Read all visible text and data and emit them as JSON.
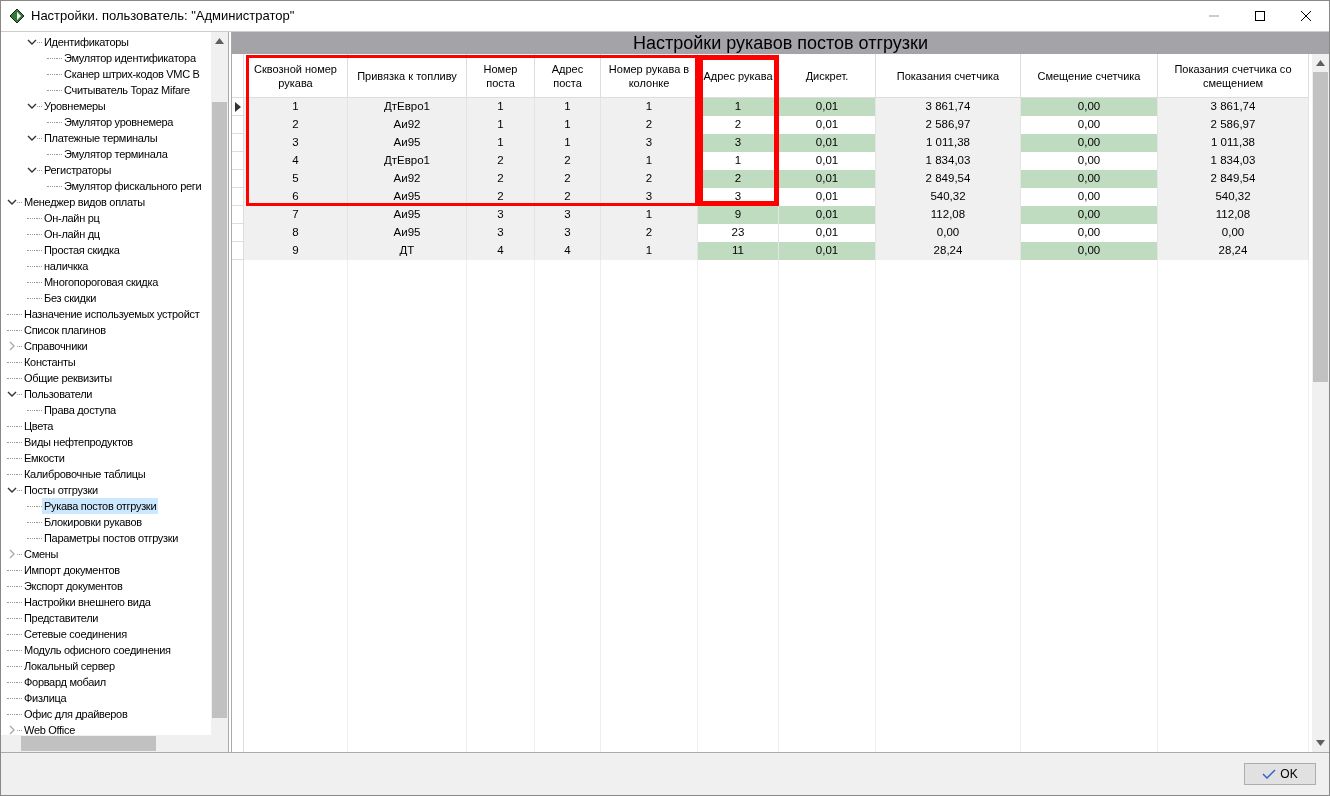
{
  "window": {
    "title": "Настройки. пользователь: \"Администратор\""
  },
  "tree": {
    "continued_items": [
      {
        "label": "Идентификаторы",
        "expanded": true,
        "selected": false,
        "children": [
          {
            "label": "Эмулятор идентификатора",
            "selected": false
          },
          {
            "label": "Сканер штрих-кодов VMC B",
            "selected": false
          },
          {
            "label": "Считыватель Topaz Mifare",
            "selected": false
          }
        ]
      },
      {
        "label": "Уровнемеры",
        "expanded": true,
        "selected": false,
        "children": [
          {
            "label": "Эмулятор уровнемера",
            "selected": false
          }
        ]
      },
      {
        "label": "Платежные терминалы",
        "expanded": true,
        "selected": false,
        "children": [
          {
            "label": "Эмулятор терминала",
            "selected": false
          }
        ]
      },
      {
        "label": "Регистраторы",
        "expanded": true,
        "selected": false,
        "children": [
          {
            "label": "Эмулятор фискального реги",
            "selected": false
          }
        ]
      }
    ],
    "items": [
      {
        "label": "Менеджер видов оплаты",
        "expanded": true,
        "selected": false,
        "children": [
          {
            "label": "Он-лайн рц",
            "selected": false
          },
          {
            "label": "Он-лайн дц",
            "selected": false
          },
          {
            "label": "Простая скидка",
            "selected": false
          },
          {
            "label": "наличкка",
            "selected": false
          },
          {
            "label": "Многопороговая скидка",
            "selected": false
          },
          {
            "label": "Без скидки",
            "selected": false
          }
        ]
      },
      {
        "label": "Назначение используемых устройст",
        "selected": false
      },
      {
        "label": "Список плагинов",
        "selected": false
      },
      {
        "label": "Справочники",
        "expanded": false,
        "selected": false
      },
      {
        "label": "Константы",
        "selected": false
      },
      {
        "label": "Общие реквизиты",
        "selected": false
      },
      {
        "label": "Пользователи",
        "expanded": true,
        "selected": false,
        "children": [
          {
            "label": "Права доступа",
            "selected": false
          }
        ]
      },
      {
        "label": "Цвета",
        "selected": false
      },
      {
        "label": "Виды нефтепродуктов",
        "selected": false
      },
      {
        "label": "Емкости",
        "selected": false
      },
      {
        "label": "Калибровочные таблицы",
        "selected": false
      },
      {
        "label": "Посты отгрузки",
        "expanded": true,
        "selected": false,
        "children": [
          {
            "label": "Рукава постов отгрузки",
            "selected": true
          },
          {
            "label": "Блокировки рукавов",
            "selected": false
          },
          {
            "label": "Параметры постов отгрузки",
            "selected": false
          }
        ]
      },
      {
        "label": "Смены",
        "expanded": false,
        "selected": false
      },
      {
        "label": "Импорт документов",
        "selected": false
      },
      {
        "label": "Экспорт документов",
        "selected": false
      },
      {
        "label": "Настройки внешнего вида",
        "selected": false
      },
      {
        "label": "Представители",
        "selected": false
      },
      {
        "label": "Сетевые соединения",
        "selected": false
      },
      {
        "label": "Модуль офисного соединения",
        "selected": false
      },
      {
        "label": "Локальный сервер",
        "selected": false
      },
      {
        "label": "Форвард мобаил",
        "selected": false
      },
      {
        "label": "Физлица",
        "selected": false
      },
      {
        "label": "Офис для драйверов",
        "selected": false
      },
      {
        "label": "Web Office",
        "expanded": false,
        "selected": false
      }
    ]
  },
  "panel": {
    "title": "Настройки рукавов постов отгрузки"
  },
  "table": {
    "columns": [
      {
        "label": "Сквозной номер рукава",
        "kind": "readonly",
        "framed": true,
        "frame_thick": false
      },
      {
        "label": "Привязка к топливу",
        "kind": "readonly",
        "framed": true,
        "frame_thick": false
      },
      {
        "label": "Номер поста",
        "kind": "readonly",
        "framed": true,
        "frame_thick": false
      },
      {
        "label": "Адрес поста",
        "kind": "readonly",
        "framed": true,
        "frame_thick": false
      },
      {
        "label": "Номер рукава в колонке",
        "kind": "readonly",
        "framed": true,
        "frame_thick": false
      },
      {
        "label": "Адрес рукава",
        "kind": "editable",
        "framed": true,
        "frame_thick": true
      },
      {
        "label": "Дискрет.",
        "kind": "editable",
        "framed": false
      },
      {
        "label": "Показания счетчика",
        "kind": "readonly",
        "framed": false
      },
      {
        "label": "Смещение счетчика",
        "kind": "editable",
        "framed": false
      },
      {
        "label": "Показания счетчика со смещением",
        "kind": "readonly",
        "framed": false
      }
    ],
    "rows": [
      {
        "current": true,
        "framed": true,
        "cells": [
          "1",
          "ДтЕвро1",
          "1",
          "1",
          "1",
          "1",
          "0,01",
          "3 861,74",
          "0,00",
          "3 861,74"
        ]
      },
      {
        "current": false,
        "framed": true,
        "cells": [
          "2",
          "Аи92",
          "1",
          "1",
          "2",
          "2",
          "0,01",
          "2 586,97",
          "0,00",
          "2 586,97"
        ]
      },
      {
        "current": false,
        "framed": true,
        "cells": [
          "3",
          "Аи95",
          "1",
          "1",
          "3",
          "3",
          "0,01",
          "1 011,38",
          "0,00",
          "1 011,38"
        ]
      },
      {
        "current": false,
        "framed": true,
        "cells": [
          "4",
          "ДтЕвро1",
          "2",
          "2",
          "1",
          "1",
          "0,01",
          "1 834,03",
          "0,00",
          "1 834,03"
        ]
      },
      {
        "current": false,
        "framed": true,
        "cells": [
          "5",
          "Аи92",
          "2",
          "2",
          "2",
          "2",
          "0,01",
          "2 849,54",
          "0,00",
          "2 849,54"
        ]
      },
      {
        "current": false,
        "framed": true,
        "cells": [
          "6",
          "Аи95",
          "2",
          "2",
          "3",
          "3",
          "0,01",
          "540,32",
          "0,00",
          "540,32"
        ]
      },
      {
        "current": false,
        "framed": false,
        "cells": [
          "7",
          "Аи95",
          "3",
          "3",
          "1",
          "9",
          "0,01",
          "112,08",
          "0,00",
          "112,08"
        ]
      },
      {
        "current": false,
        "framed": false,
        "cells": [
          "8",
          "Аи95",
          "3",
          "3",
          "2",
          "23",
          "0,01",
          "0,00",
          "0,00",
          "0,00"
        ]
      },
      {
        "current": false,
        "framed": false,
        "cells": [
          "9",
          "ДТ",
          "4",
          "4",
          "1",
          "11",
          "0,01",
          "28,24",
          "0,00",
          "28,24"
        ]
      }
    ]
  },
  "buttons": [
    {
      "label": "OK"
    }
  ]
}
